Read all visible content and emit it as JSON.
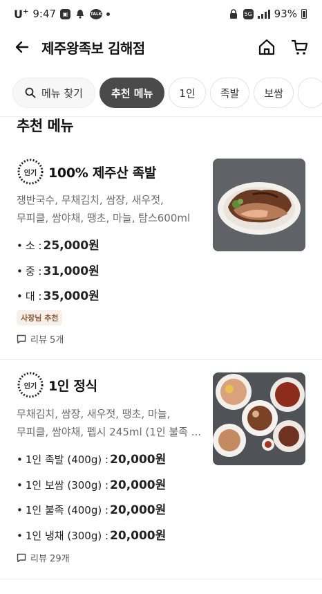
{
  "status_bar": {
    "carrier": "U",
    "carrier_sup": "+",
    "time": "9:47",
    "talk_label": "TALK",
    "network": "5G",
    "battery": "93%"
  },
  "header": {
    "title": "제주왕족보 김해점"
  },
  "tabs": [
    {
      "label": "메뉴 찾기"
    },
    {
      "label": "추천 메뉴"
    },
    {
      "label": "1인"
    },
    {
      "label": "족발"
    },
    {
      "label": "보쌈"
    }
  ],
  "section": {
    "title": "추천 메뉴"
  },
  "badge_popular": "인기",
  "menu_items": [
    {
      "name": "100% 제주산 족발",
      "desc_lines": [
        "쟁반국수, 무채김치, 쌈장, 새우젓,",
        "무피클, 쌈야채, 땡초, 마늘, 탐스600ml"
      ],
      "prices": [
        {
          "label": "소 :",
          "price": "25,000원"
        },
        {
          "label": "중 :",
          "price": "31,000원"
        },
        {
          "label": "대 :",
          "price": "35,000원"
        }
      ],
      "owner_badge": "사장님 추천",
      "review": "리뷰 5개"
    },
    {
      "name": "1인 정식",
      "desc_lines": [
        "무채김치, 쌈장, 새우젓, 땡초, 마늘,",
        "무피클, 쌈야채, 펩시 245ml (1인 불족 ..."
      ],
      "prices": [
        {
          "label": "1인 족발 (400g) :",
          "price": "20,000원"
        },
        {
          "label": "1인 보쌈 (300g) :",
          "price": "20,000원"
        },
        {
          "label": "1인 불족 (400g) :",
          "price": "20,000원"
        },
        {
          "label": "1인 냉채 (300g) :",
          "price": "20,000원"
        }
      ],
      "review": "리뷰 29개"
    }
  ],
  "colors": {
    "active_tab": "#4a4a4a",
    "owner_badge_bg": "#f8efe8",
    "owner_badge_text": "#8a5a3b"
  }
}
